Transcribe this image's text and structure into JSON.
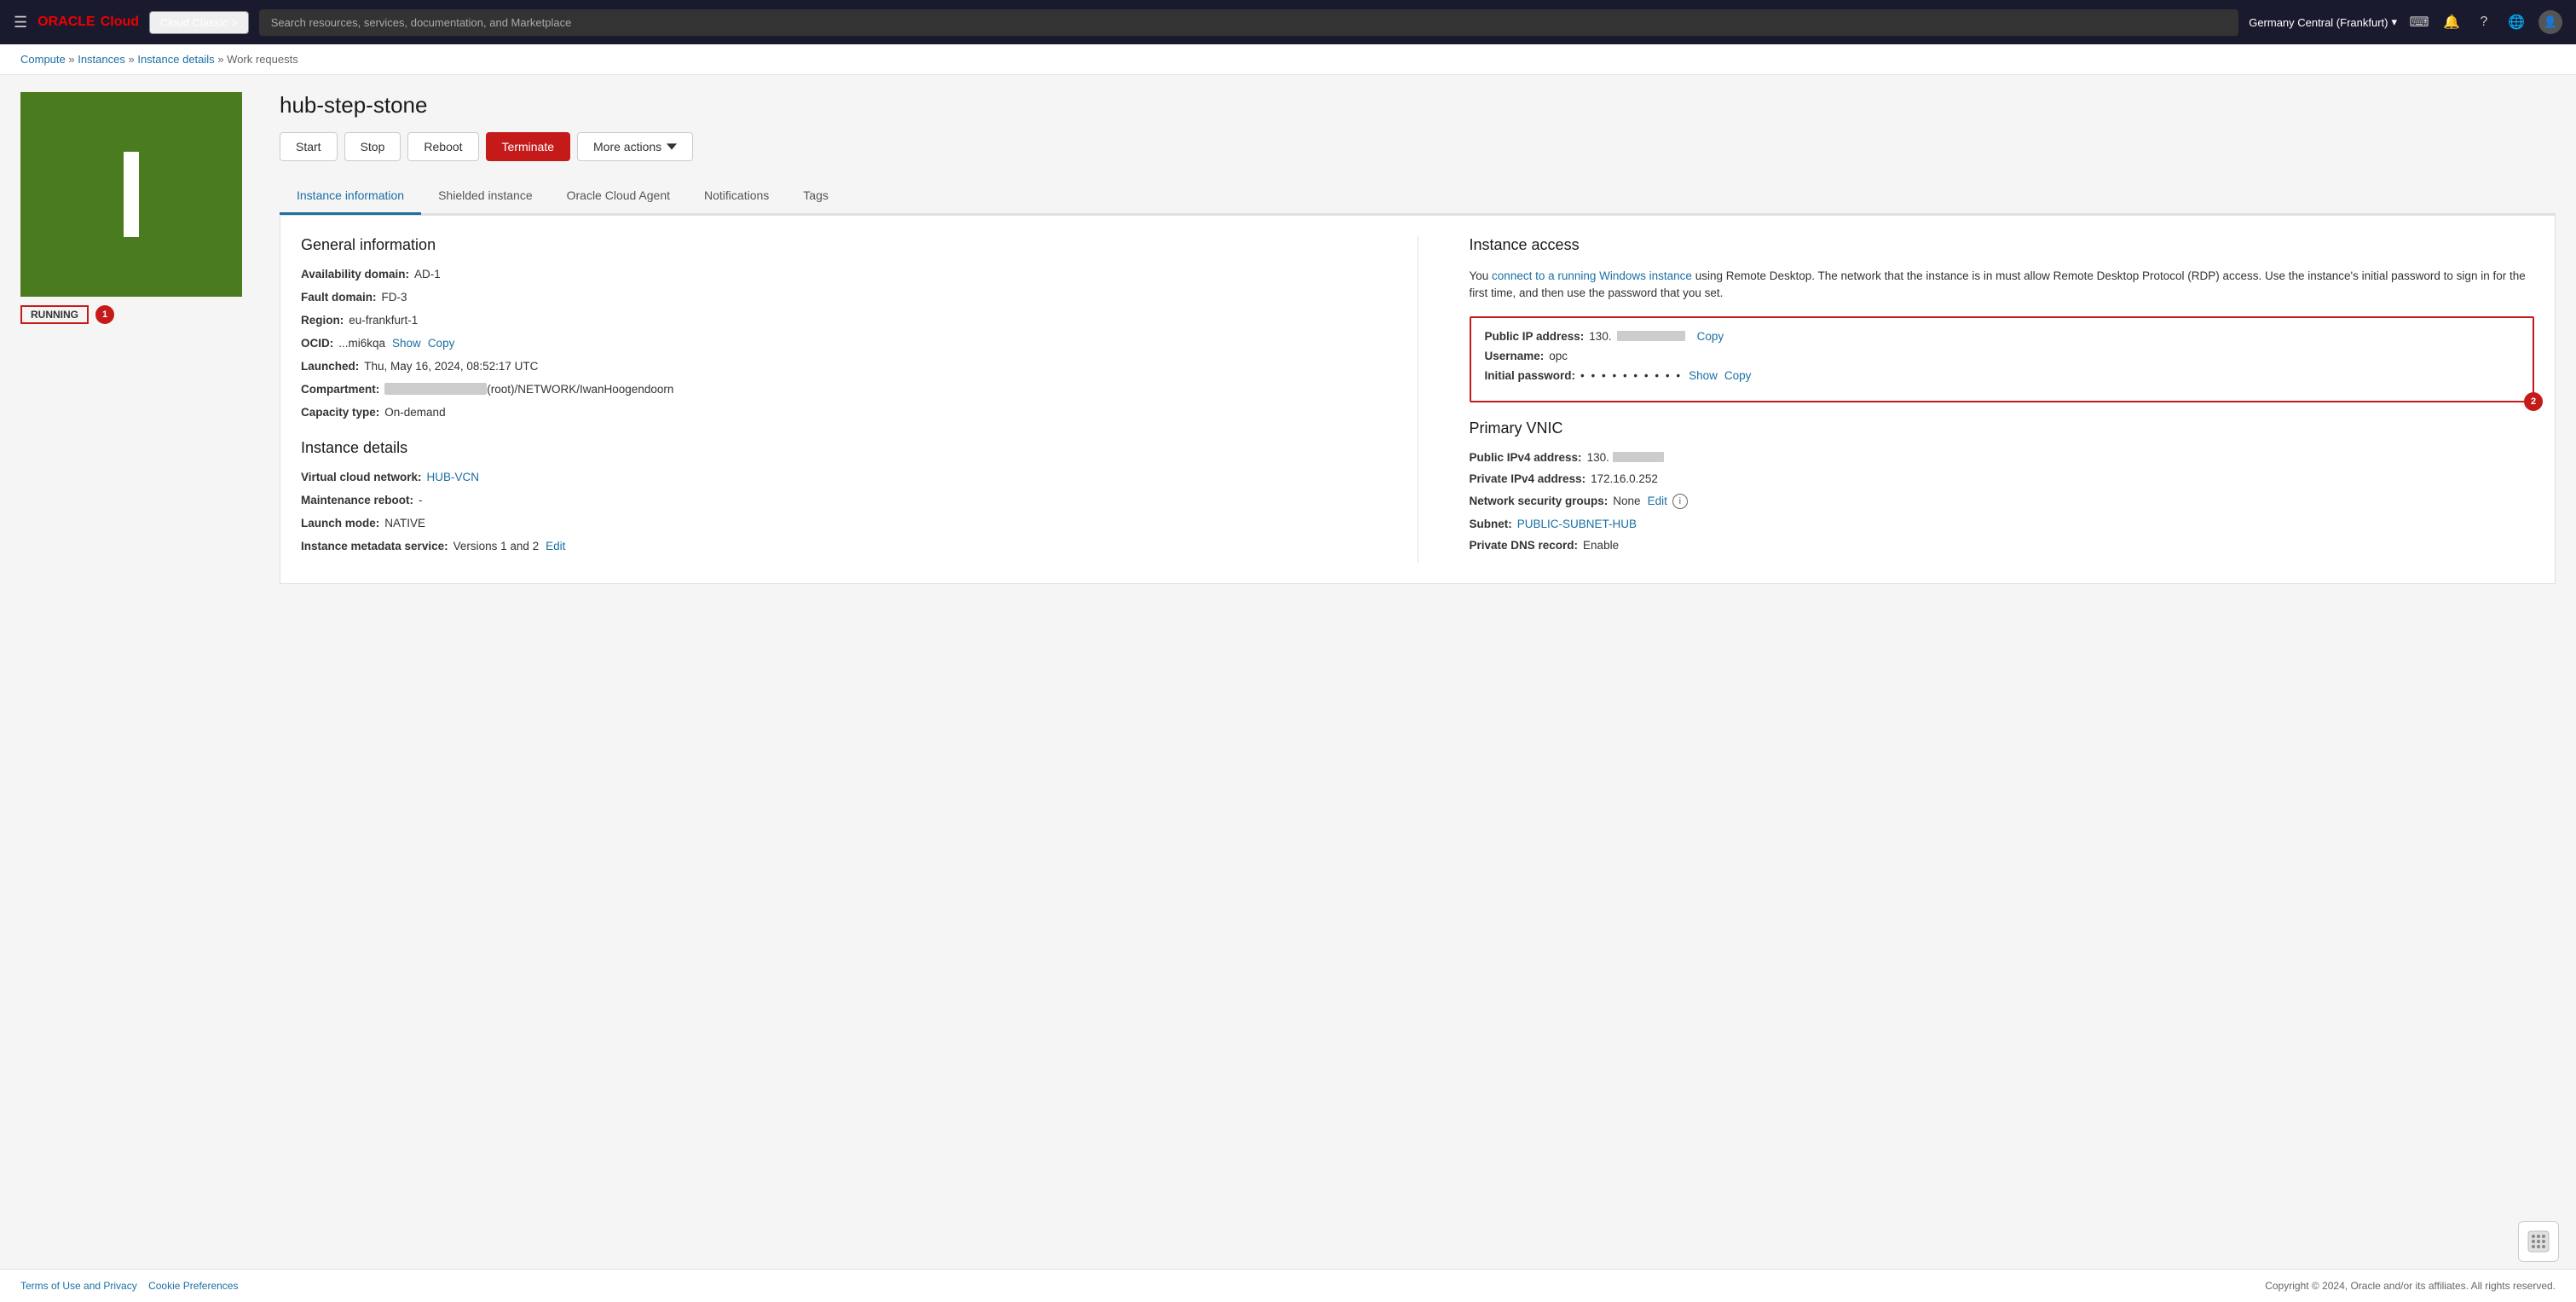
{
  "nav": {
    "hamburger_label": "☰",
    "logo_oracle": "ORACLE",
    "logo_cloud": "Cloud",
    "cloud_classic_label": "Cloud Classic >",
    "search_placeholder": "Search resources, services, documentation, and Marketplace",
    "region": "Germany Central (Frankfurt)",
    "region_chevron": "▾",
    "icons": {
      "terminal": "⌨",
      "bell": "🔔",
      "help": "?",
      "globe": "🌐",
      "user": "👤"
    }
  },
  "breadcrumb": {
    "compute": "Compute",
    "instances": "Instances",
    "instance_details": "Instance details",
    "work_requests": "Work requests"
  },
  "instance": {
    "name": "hub-step-stone",
    "status": "RUNNING",
    "status_badge_number": "1"
  },
  "buttons": {
    "start": "Start",
    "stop": "Stop",
    "reboot": "Reboot",
    "terminate": "Terminate",
    "more_actions": "More actions"
  },
  "tabs": [
    {
      "id": "instance-information",
      "label": "Instance information",
      "active": true
    },
    {
      "id": "shielded-instance",
      "label": "Shielded instance",
      "active": false
    },
    {
      "id": "oracle-cloud-agent",
      "label": "Oracle Cloud Agent",
      "active": false
    },
    {
      "id": "notifications",
      "label": "Notifications",
      "active": false
    },
    {
      "id": "tags",
      "label": "Tags",
      "active": false
    }
  ],
  "general_information": {
    "section_title": "General information",
    "availability_domain_label": "Availability domain:",
    "availability_domain_value": "AD-1",
    "fault_domain_label": "Fault domain:",
    "fault_domain_value": "FD-3",
    "region_label": "Region:",
    "region_value": "eu-frankfurt-1",
    "ocid_label": "OCID:",
    "ocid_value": "...mi6kqa",
    "ocid_show": "Show",
    "ocid_copy": "Copy",
    "launched_label": "Launched:",
    "launched_value": "Thu, May 16, 2024, 08:52:17 UTC",
    "compartment_label": "Compartment:",
    "compartment_value": "(root)/NETWORK/IwanHoogendoorn",
    "capacity_type_label": "Capacity type:",
    "capacity_type_value": "On-demand"
  },
  "instance_details": {
    "section_title": "Instance details",
    "vcn_label": "Virtual cloud network:",
    "vcn_value": "HUB-VCN",
    "maintenance_reboot_label": "Maintenance reboot:",
    "maintenance_reboot_value": "-",
    "launch_mode_label": "Launch mode:",
    "launch_mode_value": "NATIVE",
    "instance_metadata_label": "Instance metadata service:",
    "instance_metadata_value": "Versions 1 and 2",
    "instance_metadata_edit": "Edit"
  },
  "instance_access": {
    "section_title": "Instance access",
    "description_text": "You",
    "description_link_text": "connect to a running Windows instance",
    "description_rest": "using Remote Desktop. The network that the instance is in must allow Remote Desktop Protocol (RDP) access. Use the instance's initial password to sign in for the first time, and then use the password that you set.",
    "public_ip_label": "Public IP address:",
    "public_ip_value": "130.",
    "public_ip_copy": "Copy",
    "username_label": "Username:",
    "username_value": "opc",
    "initial_password_label": "Initial password:",
    "initial_password_dots": "• • • • • • • • • •",
    "password_show": "Show",
    "password_copy": "Copy",
    "badge_number": "2"
  },
  "primary_vnic": {
    "section_title": "Primary VNIC",
    "public_ipv4_label": "Public IPv4 address:",
    "public_ipv4_value": "130.",
    "private_ipv4_label": "Private IPv4 address:",
    "private_ipv4_value": "172.16.0.252",
    "nsg_label": "Network security groups:",
    "nsg_value": "None",
    "nsg_edit": "Edit",
    "subnet_label": "Subnet:",
    "subnet_value": "PUBLIC-SUBNET-HUB",
    "private_dns_label": "Private DNS record:",
    "private_dns_value": "Enable"
  },
  "footer": {
    "terms": "Terms of Use and Privacy",
    "cookie": "Cookie Preferences",
    "copyright": "Copyright © 2024, Oracle and/or its affiliates. All rights reserved."
  }
}
